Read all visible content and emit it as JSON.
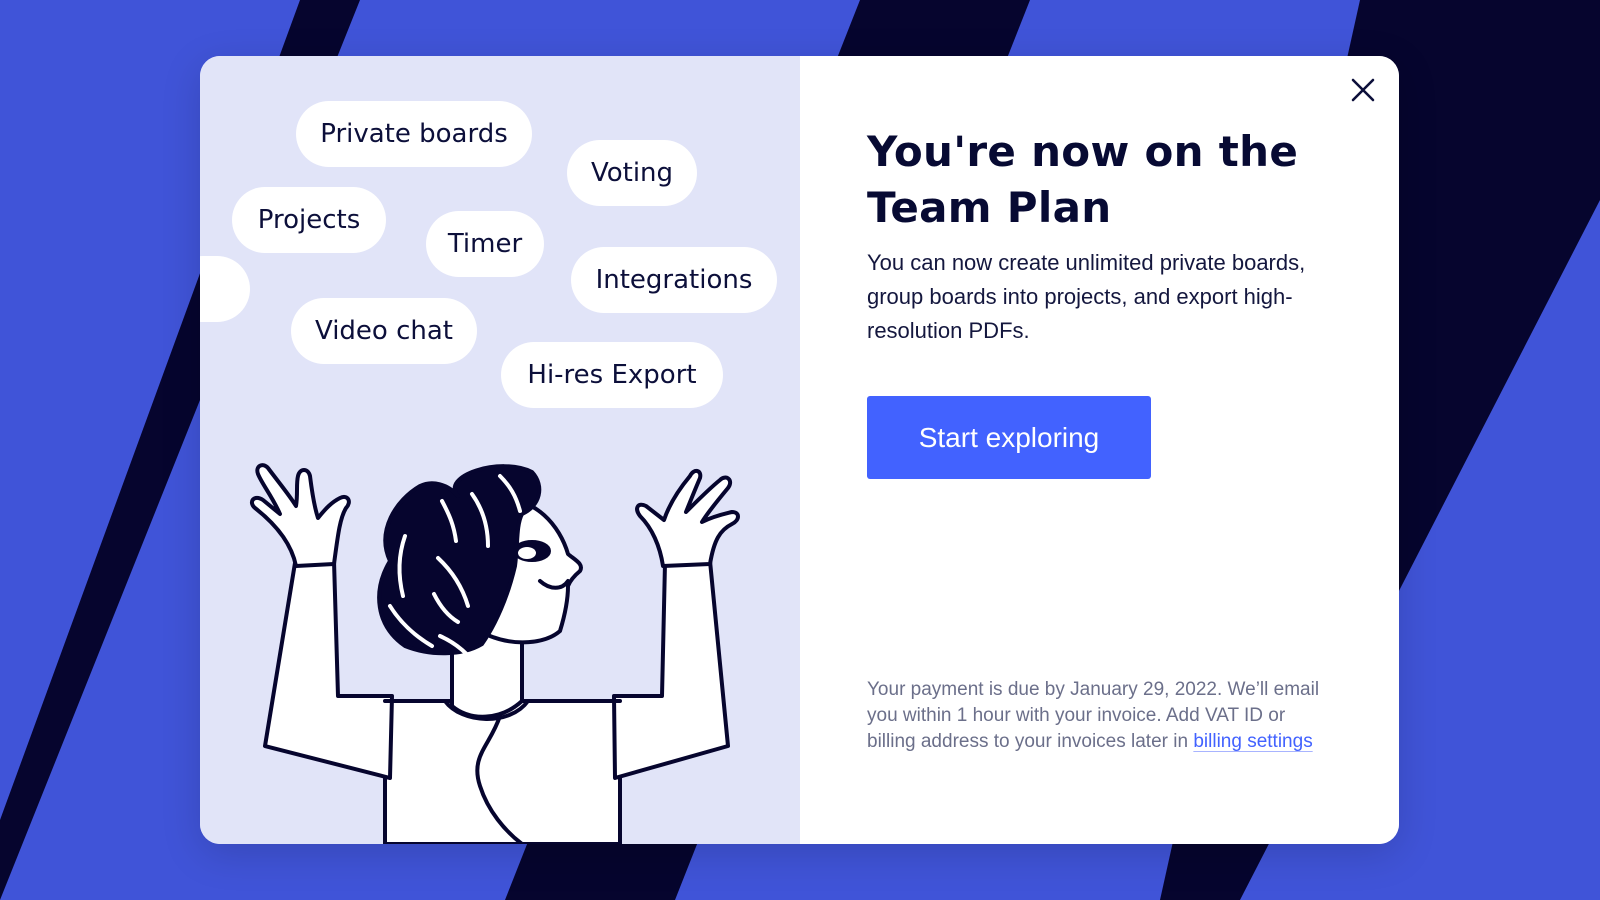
{
  "colors": {
    "background": "#4054d8",
    "stripe": "#06052e",
    "illustration_bg": "#e1e4f8",
    "accent": "#4262ff",
    "title": "#070a33"
  },
  "features": [
    "Private boards",
    "Voting",
    "Projects",
    "Timer",
    "Integrations",
    "Video chat",
    "Hi-res Export"
  ],
  "dialog": {
    "close_icon": "close-icon",
    "title": "You're now on the Team Plan",
    "description": "You can now create unlimited private boards, group boards into projects, and export high-resolution PDFs.",
    "cta_label": "Start exploring",
    "payment_note": "Your payment is due by January 29, 2022. We’ll email you within 1 hour with your invoice. Add VAT ID or billing address to your invoices later in",
    "billing_link": "billing settings"
  }
}
